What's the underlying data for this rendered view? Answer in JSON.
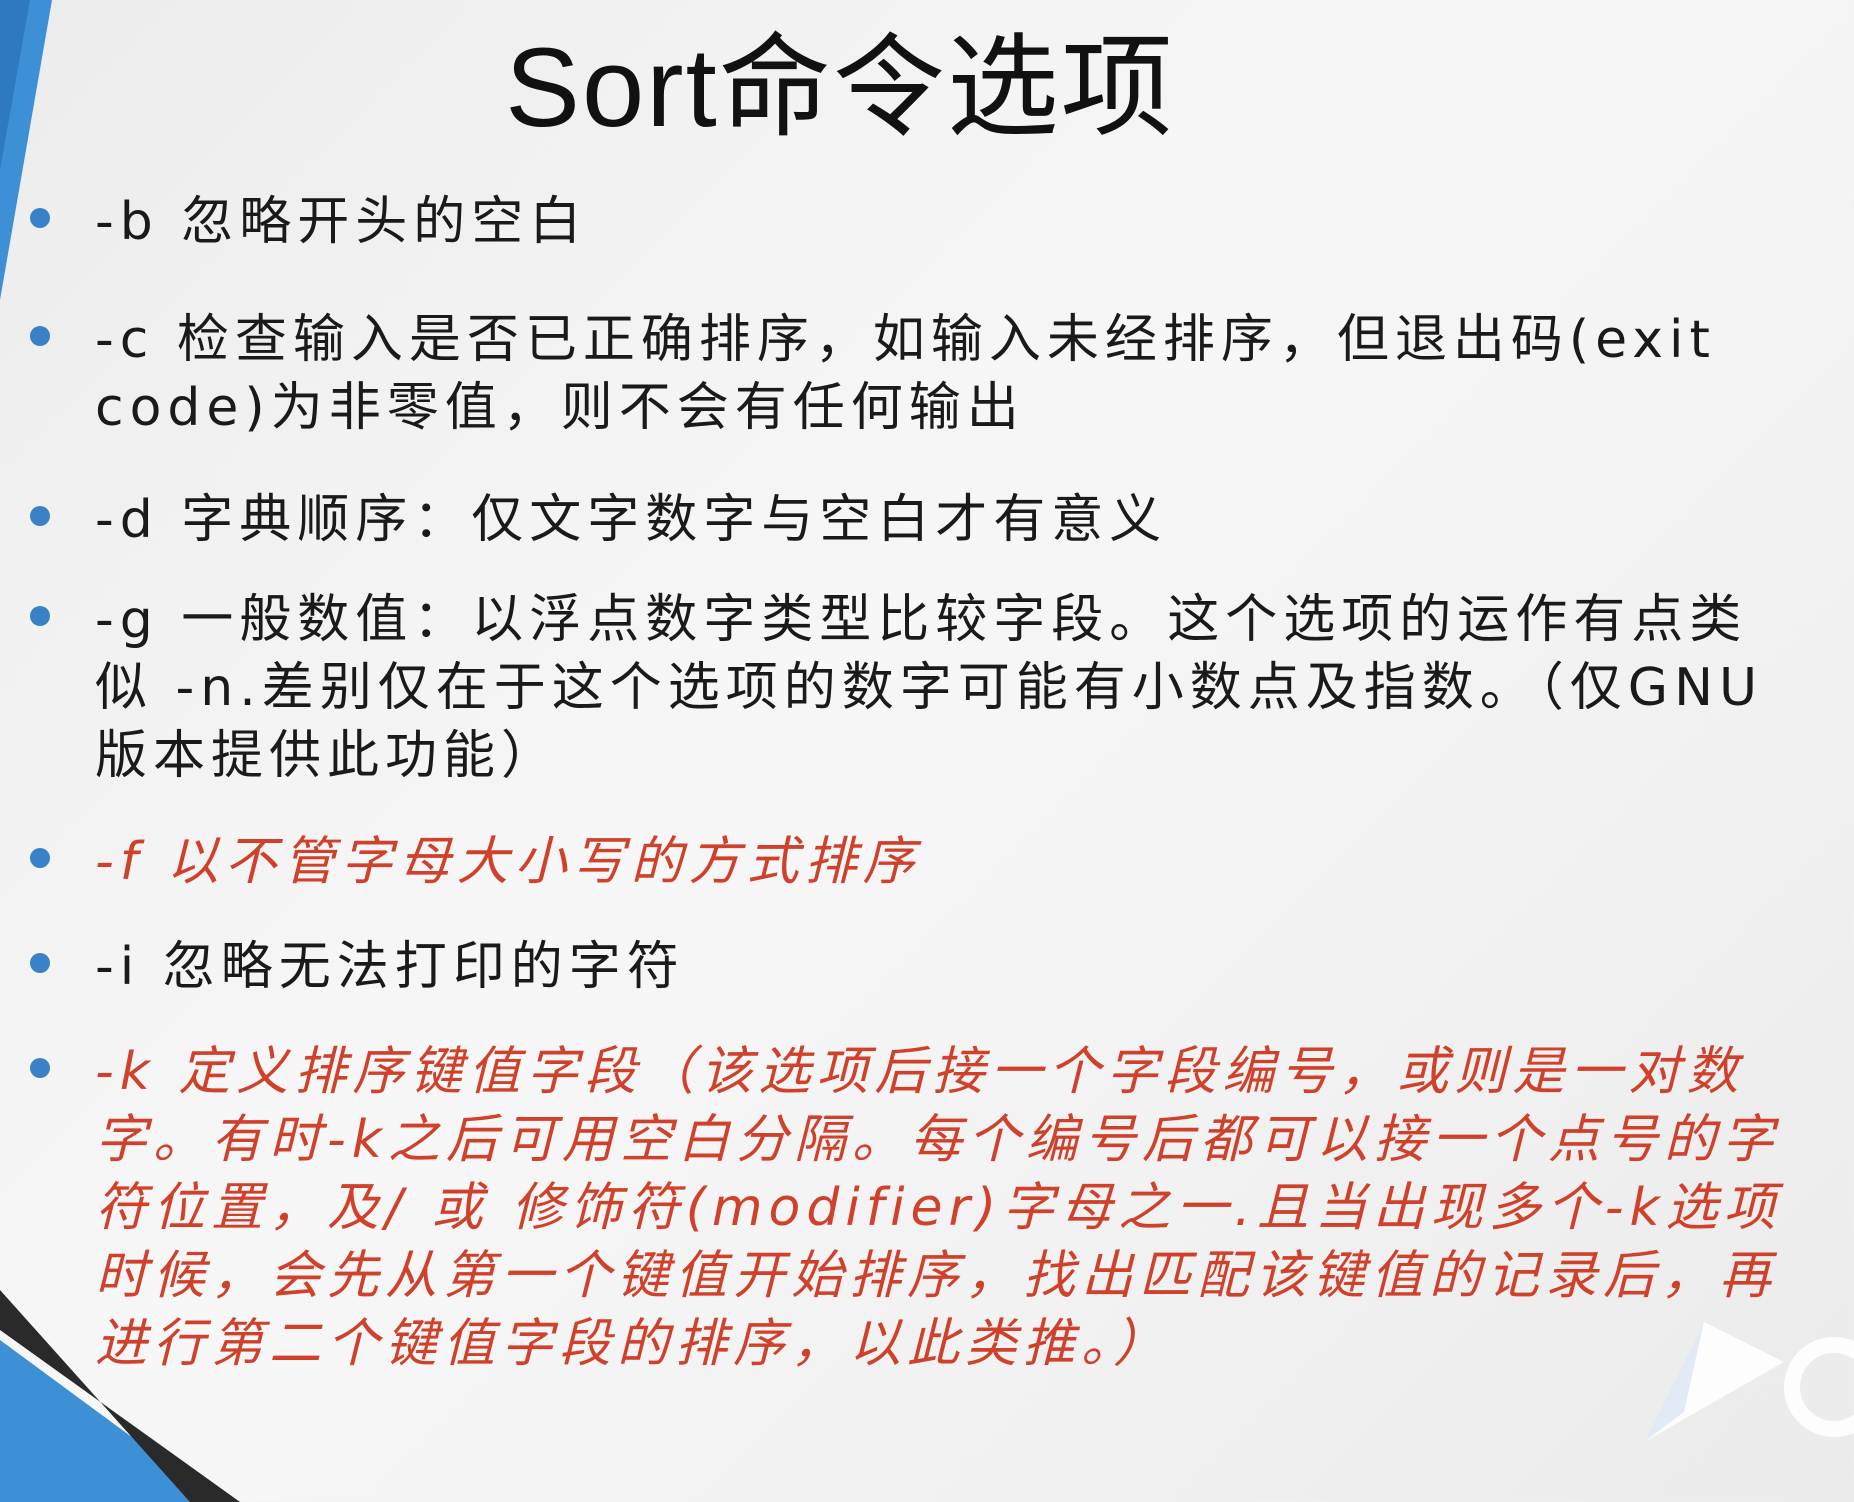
{
  "slide": {
    "title": "Sort命令选项",
    "bullets": [
      {
        "text": "-b  忽略开头的空白",
        "highlight": false
      },
      {
        "text": "-c 检查输入是否已正确排序，如输入未经排序，但退出码(exit code)为非零值，则不会有任何输出",
        "highlight": false
      },
      {
        "text": "-d 字典顺序：仅文字数字与空白才有意义",
        "highlight": false
      },
      {
        "text": "-g 一般数值：以浮点数字类型比较字段。这个选项的运作有点类似 -n.差别仅在于这个选项的数字可能有小数点及指数。（仅GNU版本提供此功能）",
        "highlight": false
      },
      {
        "text": "-f 以不管字母大小写的方式排序",
        "highlight": true
      },
      {
        "text": "-i 忽略无法打印的字符",
        "highlight": false
      },
      {
        "text": "-k 定义排序键值字段（该选项后接一个字段编号，或则是一对数字。有时-k之后可用空白分隔。每个编号后都可以接一个点号的字符位置，及/ 或 修饰符(modifier)字母之一.且当出现多个-k选项时候，会先从第一个键值开始排序，找出匹配该键值的记录后，再进行第二个键值字段的排序，以此类推。）",
        "highlight": true
      }
    ]
  },
  "colors": {
    "text": "#1a1a1a",
    "highlight": "#d0412b",
    "bullet_dot": "#3a82c8",
    "accent_blue": "#3d8fd6"
  },
  "icons": {
    "watermark": "player-logo-icon"
  }
}
